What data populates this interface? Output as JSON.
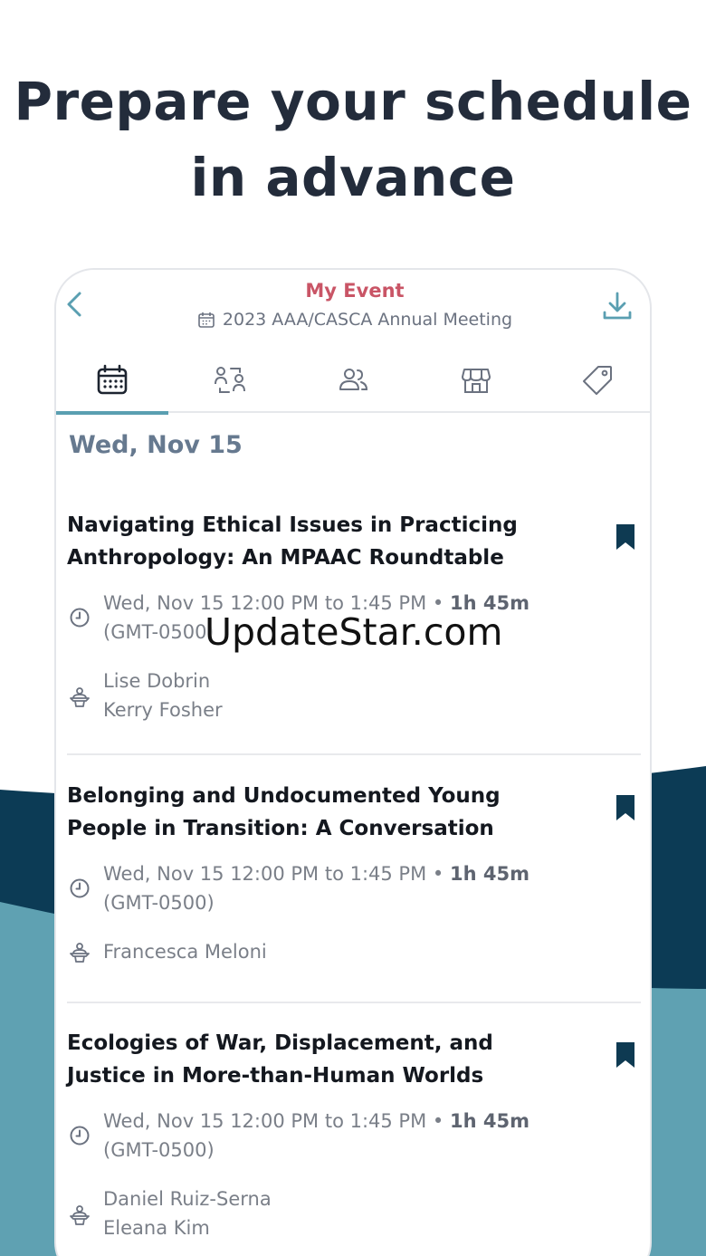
{
  "headline": {
    "line1": "Prepare your schedule",
    "line2": "in advance"
  },
  "topbar": {
    "title": "My Event",
    "subtitle": "2023 AAA/CASCA Annual Meeting",
    "icons": [
      "back-arrow-icon",
      "calendar-icon",
      "download-icon"
    ]
  },
  "tabs": [
    {
      "icon": "calendar-grid-icon",
      "active": true
    },
    {
      "icon": "people-connect-icon",
      "active": false
    },
    {
      "icon": "attendees-icon",
      "active": false
    },
    {
      "icon": "storefront-icon",
      "active": false
    },
    {
      "icon": "tag-icon",
      "active": false
    }
  ],
  "day_header": "Wed, Nov 15",
  "sessions": [
    {
      "title_line1": "Navigating Ethical Issues in Practicing",
      "title_line2": "Anthropology: An MPAAC Roundtable",
      "time": "Wed, Nov 15 12:00 PM to 1:45 PM",
      "duration": "1h 45m",
      "timezone": "(GMT-0500)",
      "speakers": [
        "Lise Dobrin",
        "Kerry Fosher"
      ]
    },
    {
      "title_line1": "Belonging and Undocumented Young",
      "title_line2": "People in Transition: A Conversation",
      "time": "Wed, Nov 15 12:00 PM to 1:45 PM",
      "duration": "1h 45m",
      "timezone": "(GMT-0500)",
      "speakers": [
        "Francesca Meloni"
      ]
    },
    {
      "title_line1": "Ecologies of War, Displacement, and",
      "title_line2": "Justice in More-than-Human Worlds",
      "time": "Wed, Nov 15 12:00 PM to 1:45 PM",
      "duration": "1h 45m",
      "timezone": "(GMT-0500)",
      "speakers": [
        "Daniel Ruiz-Serna",
        "Eleana Kim"
      ]
    }
  ],
  "watermark": "UpdateStar.com",
  "colors": {
    "accent": "#5a9fb1",
    "title_pink": "#c95566",
    "bookmark": "#0e3a52",
    "wave_dark": "#0c3b55",
    "wave_light": "#5fa1b2",
    "headline": "#232c3b"
  }
}
